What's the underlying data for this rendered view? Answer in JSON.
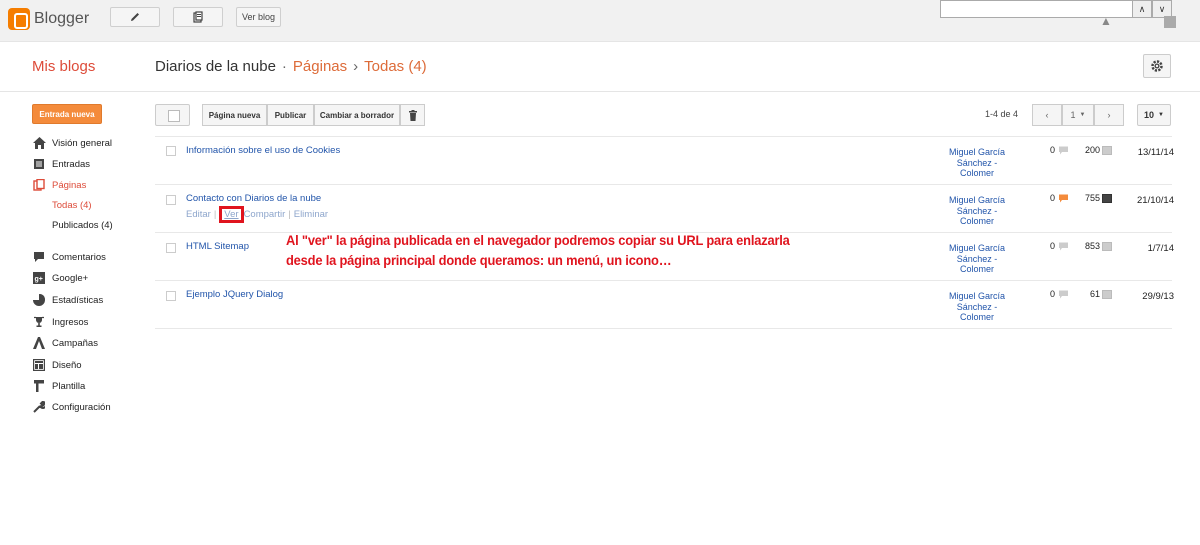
{
  "topbar": {
    "logo_text": "Blogger",
    "view_blog_label": "Ver blog",
    "search_value": ""
  },
  "header": {
    "my_blogs": "Mis blogs",
    "breadcrumb": [
      {
        "label": "Diarios de la nube"
      },
      {
        "label": "Páginas"
      },
      {
        "label": "Todas (4)"
      }
    ],
    "separator": "·",
    "separator2": "›"
  },
  "sidebar": {
    "new_post_label": "Entrada nueva",
    "items": [
      {
        "label": "Visión general",
        "icon": "home-icon"
      },
      {
        "label": "Entradas",
        "icon": "posts-icon"
      },
      {
        "label": "Páginas",
        "icon": "pages-icon"
      },
      {
        "label": "Comentarios",
        "icon": "comments-icon"
      },
      {
        "label": "Google+",
        "icon": "google-plus-icon"
      },
      {
        "label": "Estadísticas",
        "icon": "stats-icon"
      },
      {
        "label": "Ingresos",
        "icon": "trophy-icon"
      },
      {
        "label": "Campañas",
        "icon": "campaigns-icon"
      },
      {
        "label": "Diseño",
        "icon": "layout-icon"
      },
      {
        "label": "Plantilla",
        "icon": "template-icon"
      },
      {
        "label": "Configuración",
        "icon": "wrench-icon"
      }
    ],
    "sub_items": [
      {
        "label": "Todas (4)"
      },
      {
        "label": "Publicados (4)"
      }
    ]
  },
  "toolbar": {
    "new_page": "Página nueva",
    "publish": "Publicar",
    "to_draft": "Cambiar a borrador",
    "pager_text": "1-4 de 4",
    "page_number": "1",
    "per_page": "10"
  },
  "rows": [
    {
      "title": "Información sobre el uso de Cookies",
      "author": "Miguel García Sánchez - Colomer",
      "comments": "0",
      "views": "200",
      "date": "13/11/14"
    },
    {
      "title": "Contacto con Diarios de la nube",
      "author": "Miguel García Sánchez - Colomer",
      "comments": "0",
      "views": "755",
      "date": "21/10/14",
      "actions": {
        "edit": "Editar",
        "view": "Ver",
        "share": "Compartir",
        "delete": "Eliminar",
        "pipe": "|"
      }
    },
    {
      "title": "HTML Sitemap",
      "author": "Miguel García Sánchez - Colomer",
      "comments": "0",
      "views": "853",
      "date": "1/7/14"
    },
    {
      "title": "Ejemplo JQuery Dialog",
      "author": "Miguel García Sánchez - Colomer",
      "comments": "0",
      "views": "61",
      "date": "29/9/13"
    }
  ],
  "annotation": {
    "line1": "Al \"ver\" la página publicada en el navegador podremos copiar su URL para enlazarla",
    "line2": "desde la página principal donde queramos: un menú, un icono…"
  },
  "colors": {
    "accent": "#dd4b39",
    "link": "#2255aa",
    "annotation": "#e0141e",
    "new_post": "#f48b3b"
  }
}
